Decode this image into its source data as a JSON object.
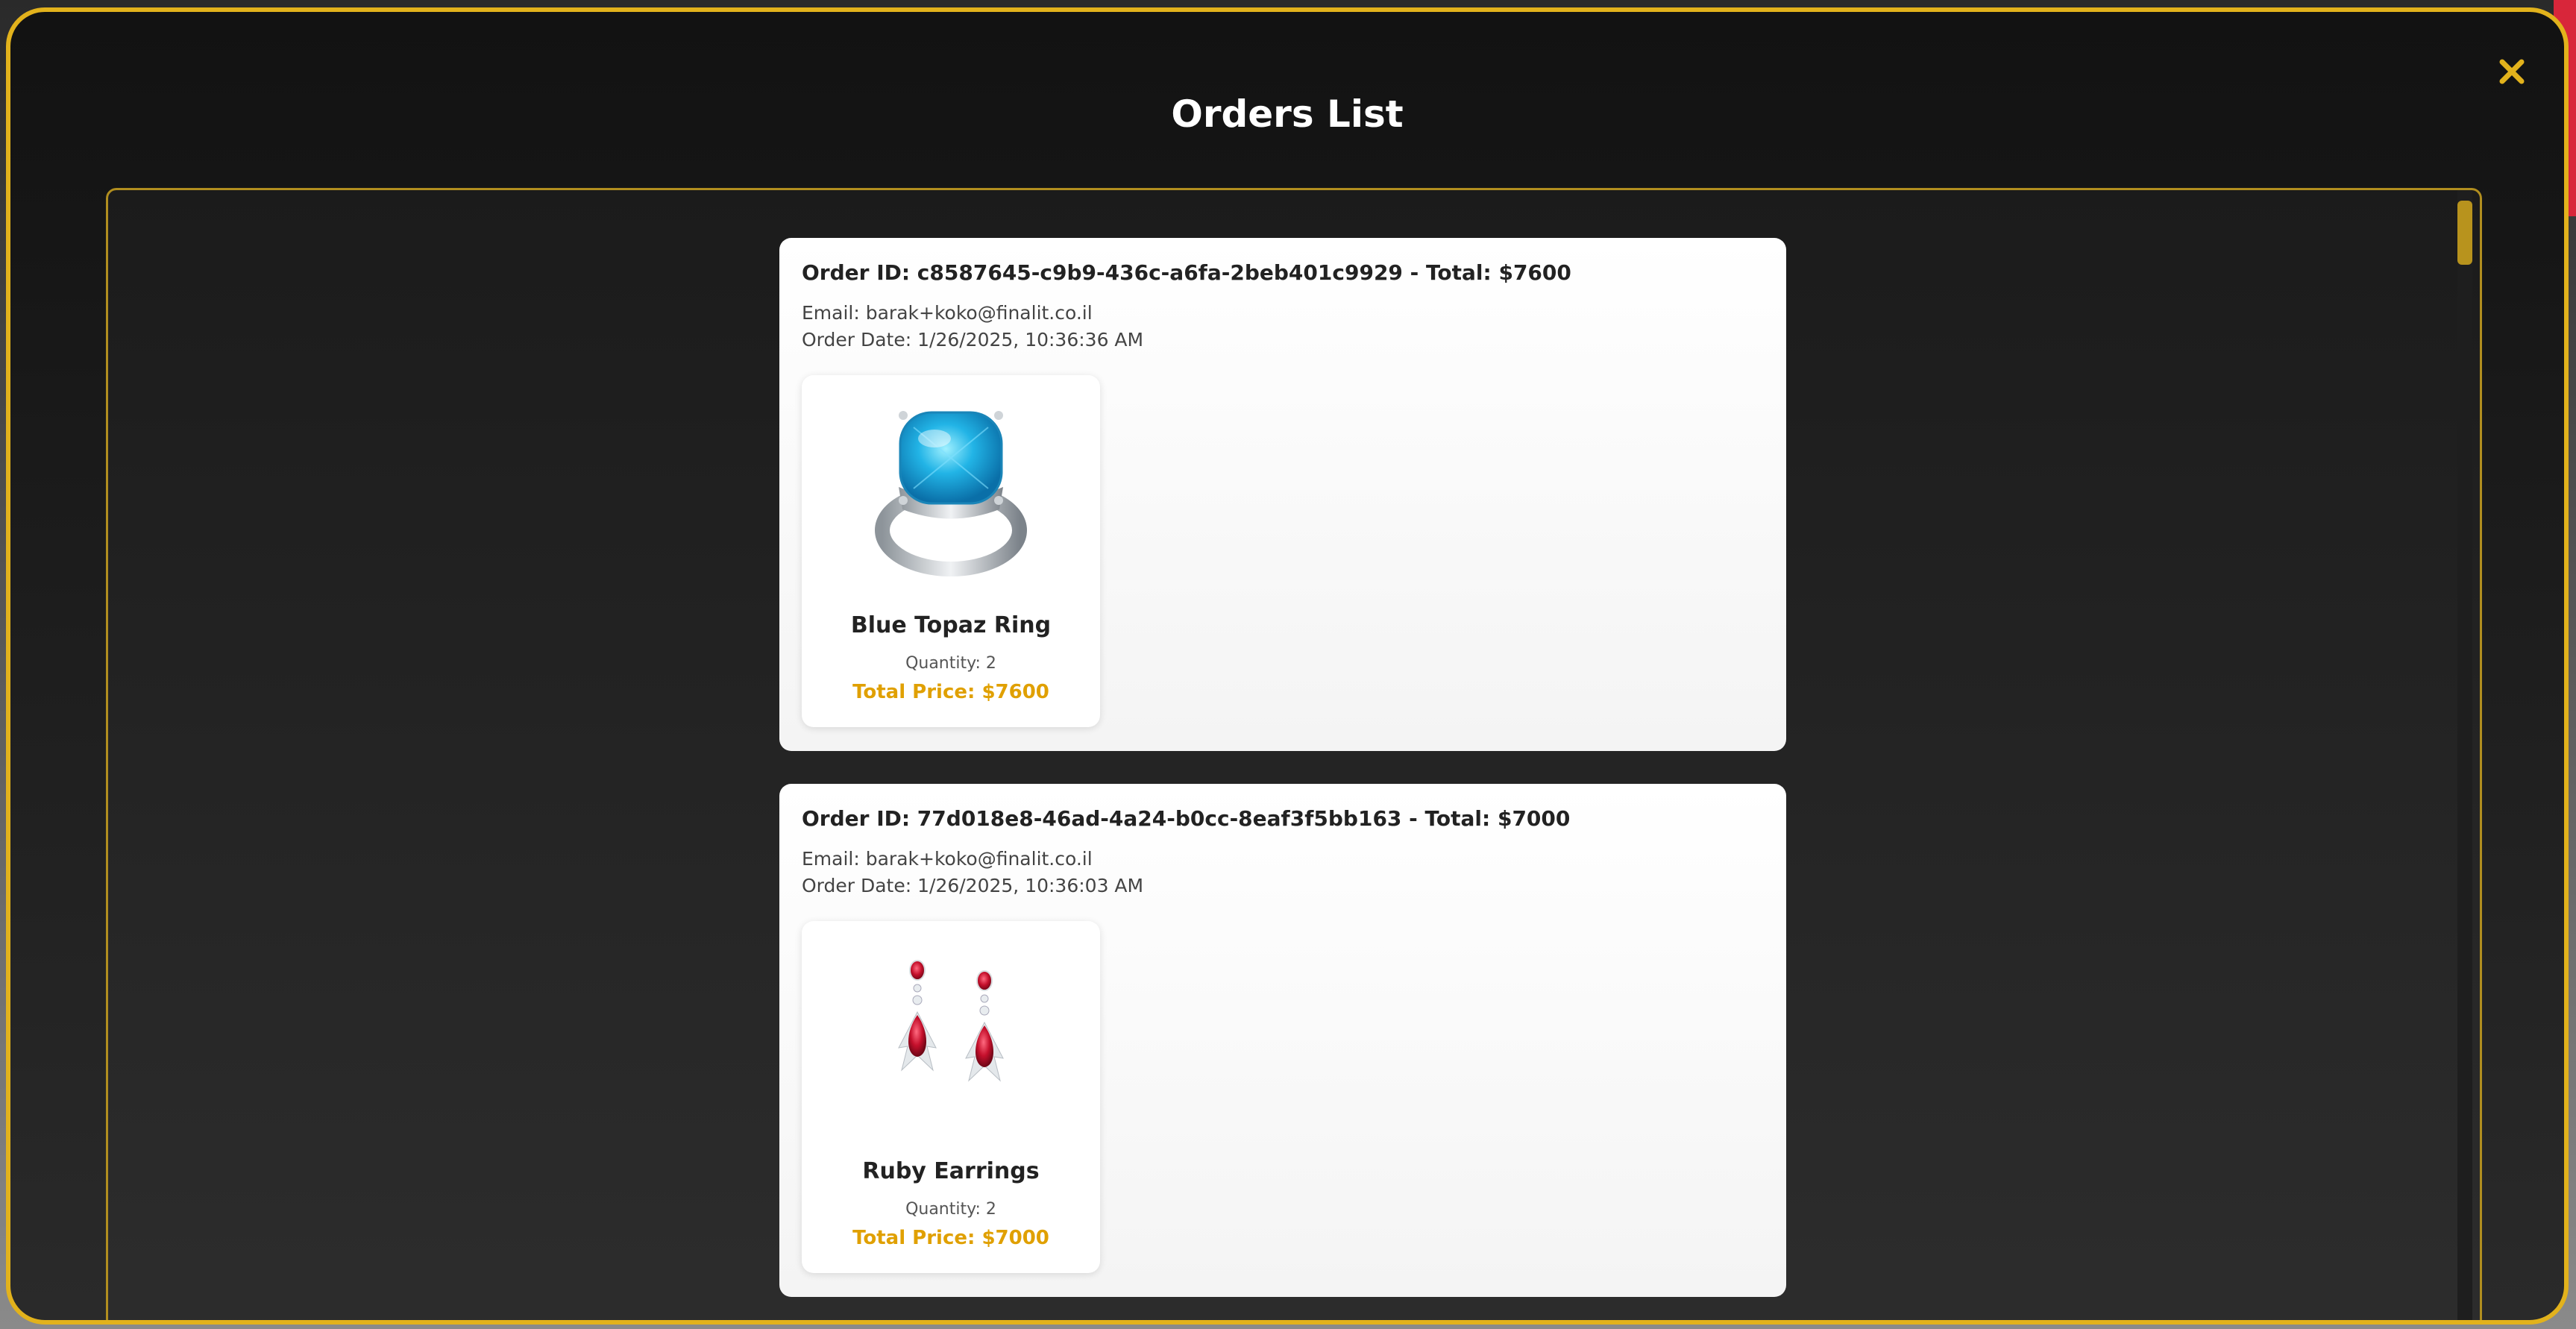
{
  "modal": {
    "title": "Orders List",
    "close_icon": "close-icon"
  },
  "colors": {
    "accent": "#e2b21c",
    "price": "#e0a000",
    "modal_bg": "#1a1a1a",
    "card_bg": "#ffffff"
  },
  "orders": [
    {
      "header": "Order ID: c8587645-c9b9-436c-a6fa-2beb401c9929 - Total: $7600",
      "email": "Email: barak+koko@finalit.co.il",
      "date": "Order Date: 1/26/2025, 10:36:36 AM",
      "items": [
        {
          "name": "Blue Topaz Ring",
          "quantity": "Quantity: 2",
          "total": "Total Price: $7600",
          "image_icon": "blue-topaz-ring-image"
        }
      ]
    },
    {
      "header": "Order ID: 77d018e8-46ad-4a24-b0cc-8eaf3f5bb163 - Total: $7000",
      "email": "Email: barak+koko@finalit.co.il",
      "date": "Order Date: 1/26/2025, 10:36:03 AM",
      "items": [
        {
          "name": "Ruby Earrings",
          "quantity": "Quantity: 2",
          "total": "Total Price: $7000",
          "image_icon": "ruby-earrings-image"
        }
      ]
    }
  ]
}
